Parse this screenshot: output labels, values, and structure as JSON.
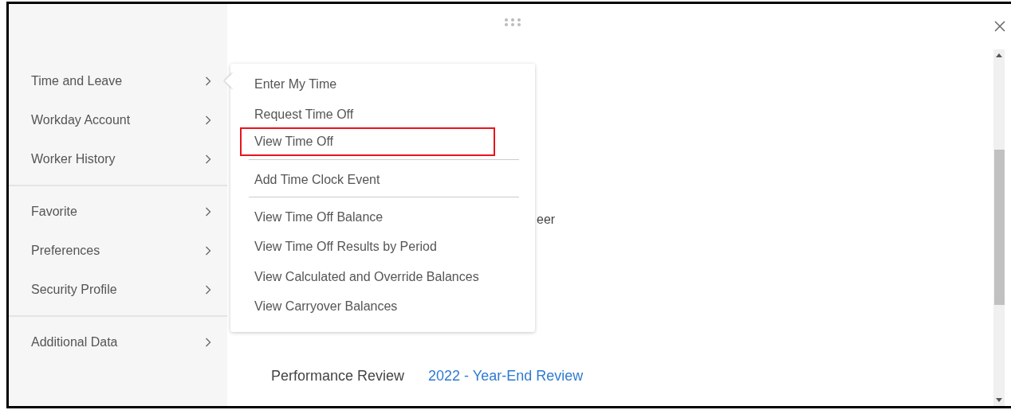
{
  "sidebar": {
    "groups": [
      {
        "items": [
          {
            "label": "Time and Leave",
            "expanded": true
          },
          {
            "label": "Workday Account",
            "expanded": false
          },
          {
            "label": "Worker History",
            "expanded": false
          }
        ]
      },
      {
        "items": [
          {
            "label": "Favorite",
            "expanded": false
          },
          {
            "label": "Preferences",
            "expanded": false
          },
          {
            "label": "Security Profile",
            "expanded": false
          }
        ]
      },
      {
        "items": [
          {
            "label": "Additional Data",
            "expanded": false
          }
        ]
      }
    ]
  },
  "flyout_menu": {
    "sections": [
      {
        "items": [
          {
            "label": "Enter My Time",
            "highlighted": false
          },
          {
            "label": "Request Time Off",
            "highlighted": false
          },
          {
            "label": "View Time Off",
            "highlighted": true
          }
        ]
      },
      {
        "items": [
          {
            "label": "Add Time Clock Event",
            "highlighted": false
          }
        ]
      },
      {
        "items": [
          {
            "label": "View Time Off Balance",
            "highlighted": false
          },
          {
            "label": "View Time Off Results by Period",
            "highlighted": false
          },
          {
            "label": "View Calculated and Override Balances",
            "highlighted": false
          },
          {
            "label": "View Carryover Balances",
            "highlighted": false
          }
        ]
      }
    ]
  },
  "content": {
    "partial_text": "eer",
    "fields": [
      {
        "label": "Performance Review",
        "value": "2022 - Year-End Review"
      }
    ]
  }
}
